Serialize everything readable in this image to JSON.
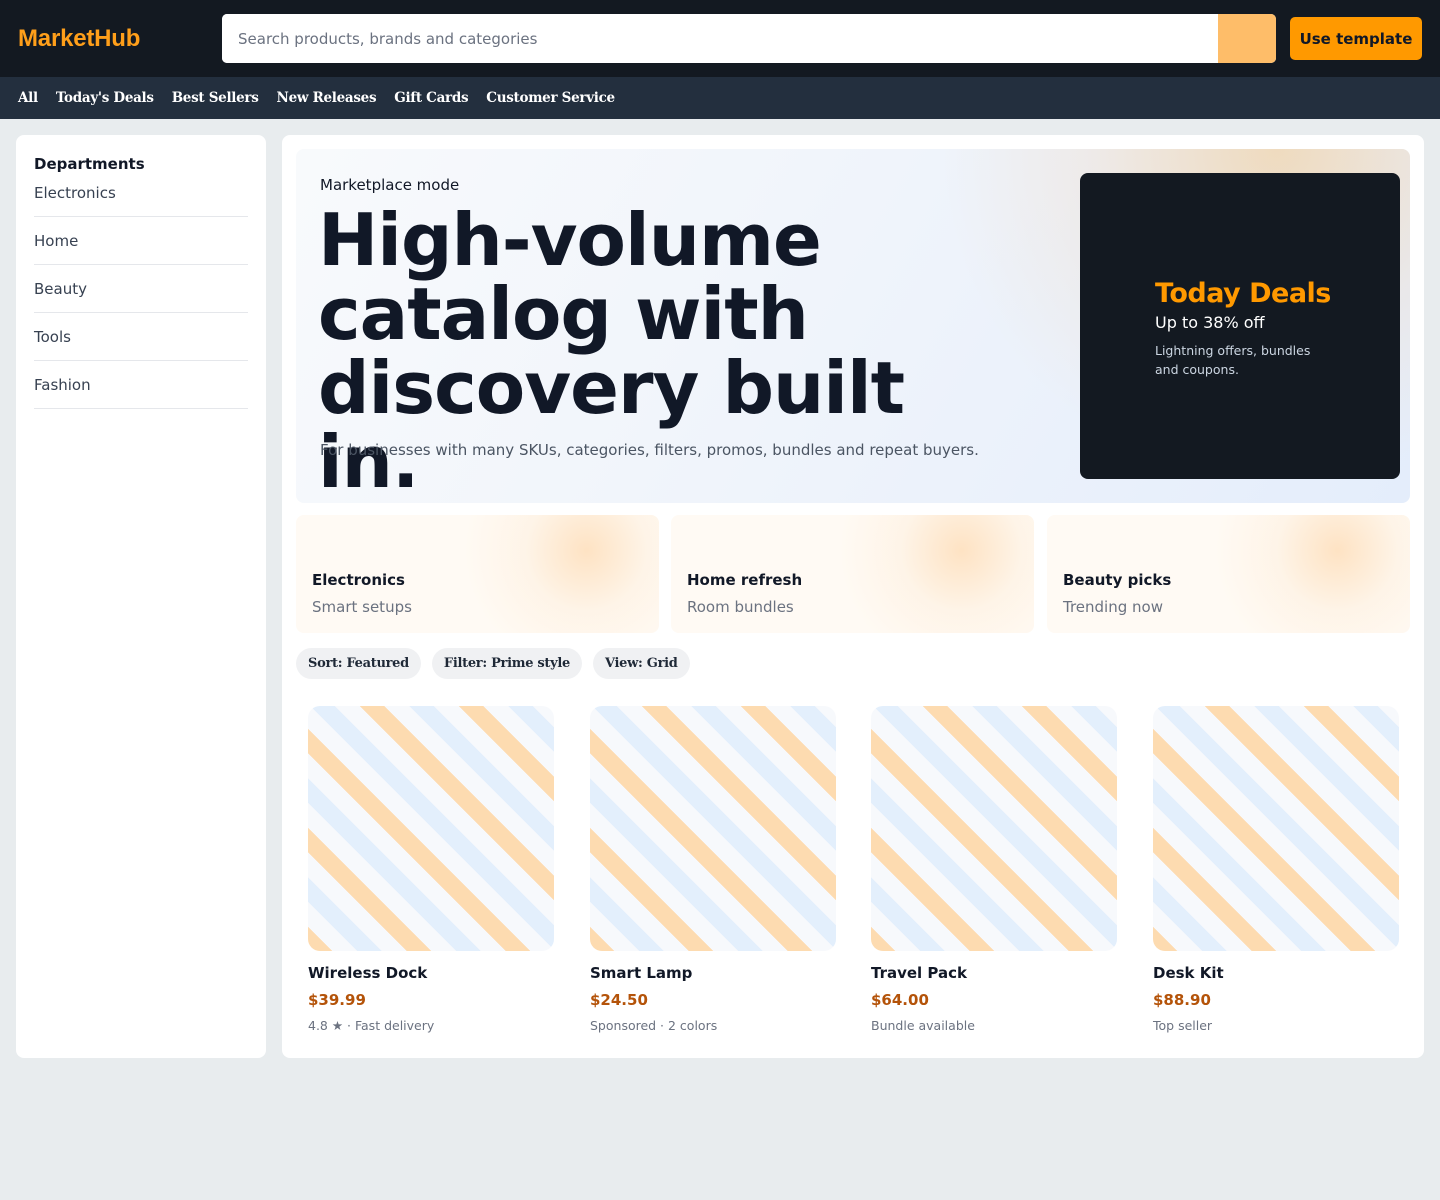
{
  "header": {
    "logo": "MarketHub",
    "search_placeholder": "Search products, brands and categories",
    "use_template": "Use template",
    "colors": {
      "bg": "#131921",
      "accent": "#ff9900",
      "search_button": "#febd69"
    }
  },
  "nav": {
    "items": [
      "All",
      "Today's Deals",
      "Best Sellers",
      "New Releases",
      "Gift Cards",
      "Customer Service"
    ]
  },
  "sidebar": {
    "title": "Departments",
    "items": [
      "Electronics",
      "Home",
      "Beauty",
      "Tools",
      "Fashion"
    ]
  },
  "hero": {
    "kicker": "Marketplace mode",
    "title": "High-volume catalog with discovery built in.",
    "subtitle": "For businesses with many SKUs, categories, filters, promos, bundles and repeat buyers.",
    "deal": {
      "title": "Today Deals",
      "subtitle": "Up to 38% off",
      "description": "Lightning offers, bundles and coupons."
    }
  },
  "categories": [
    {
      "title": "Electronics",
      "subtitle": "Smart setups"
    },
    {
      "title": "Home refresh",
      "subtitle": "Room bundles"
    },
    {
      "title": "Beauty picks",
      "subtitle": "Trending now"
    }
  ],
  "chips": [
    "Sort: Featured",
    "Filter: Prime style",
    "View: Grid"
  ],
  "products": [
    {
      "name": "Wireless Dock",
      "price": "$39.99",
      "meta": "4.8 ★ · Fast delivery"
    },
    {
      "name": "Smart Lamp",
      "price": "$24.50",
      "meta": "Sponsored · 2 colors"
    },
    {
      "name": "Travel Pack",
      "price": "$64.00",
      "meta": "Bundle available"
    },
    {
      "name": "Desk Kit",
      "price": "$88.90",
      "meta": "Top seller"
    }
  ]
}
